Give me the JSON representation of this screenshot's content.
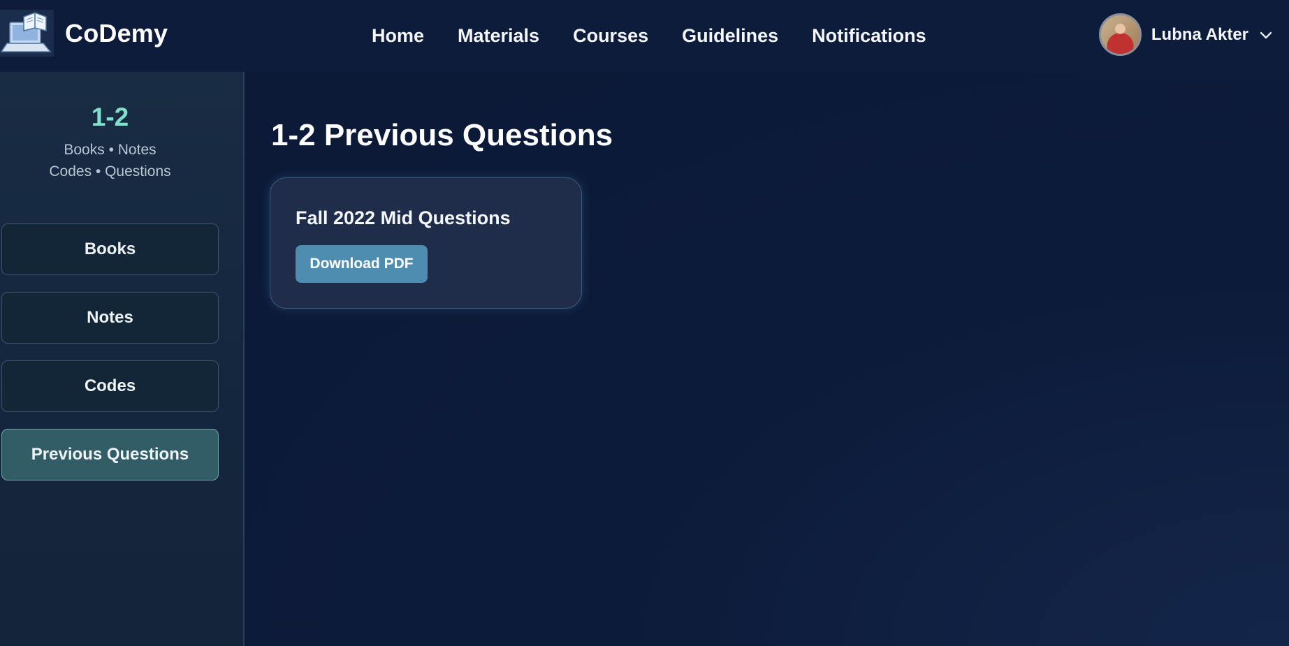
{
  "header": {
    "brand": "CoDemy",
    "nav": [
      {
        "label": "Home"
      },
      {
        "label": "Materials"
      },
      {
        "label": "Courses"
      },
      {
        "label": "Guidelines"
      },
      {
        "label": "Notifications"
      }
    ],
    "user": {
      "name": "Lubna Akter"
    }
  },
  "sidebar": {
    "title": "1-2",
    "subtitle_line1": "Books • Notes",
    "subtitle_line2": "Codes • Questions",
    "items": [
      {
        "label": "Books",
        "active": false
      },
      {
        "label": "Notes",
        "active": false
      },
      {
        "label": "Codes",
        "active": false
      },
      {
        "label": "Previous Questions",
        "active": true
      }
    ]
  },
  "main": {
    "title": "1-2 Previous Questions",
    "cards": [
      {
        "title": "Fall 2022 Mid Questions",
        "button_label": "Download PDF"
      }
    ]
  },
  "colors": {
    "background": "#0c1a38",
    "accent": "#7fe0cc",
    "button": "#4f8db0",
    "active_sidebar": "#325c66"
  }
}
